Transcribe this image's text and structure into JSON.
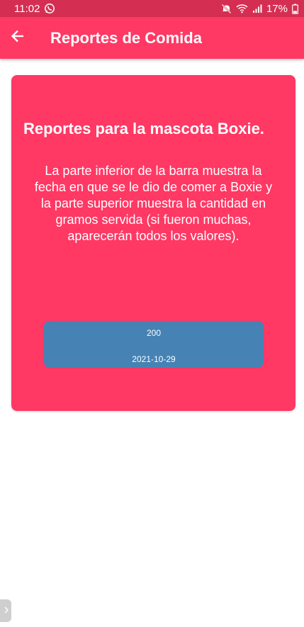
{
  "status_bar": {
    "time": "11:02",
    "whatsapp_icon": "whatsapp-icon",
    "mute_icon": "mute-icon",
    "wifi_icon": "wifi-icon",
    "signal_icon": "signal-icon",
    "battery_percent": "17%",
    "battery_icon": "battery-icon"
  },
  "app_bar": {
    "back_icon": "arrow-left-icon",
    "title": "Reportes de Comida"
  },
  "card": {
    "title": "Reportes para la mascota Boxie.",
    "description": "La parte inferior de la barra muestra la fecha en que se le dio de comer a Boxie y la parte superior muestra la cantidad en gramos servida (si fueron muchas, aparecerán todos los valores).",
    "bar": {
      "amount": "200",
      "date": "2021-10-29"
    }
  },
  "edge_handle": {
    "icon": "chevron-right-icon"
  },
  "colors": {
    "status_bar": "#d42f52",
    "primary": "#ff3864",
    "bar": "#4682b4",
    "text_on_primary": "#ffffff"
  }
}
